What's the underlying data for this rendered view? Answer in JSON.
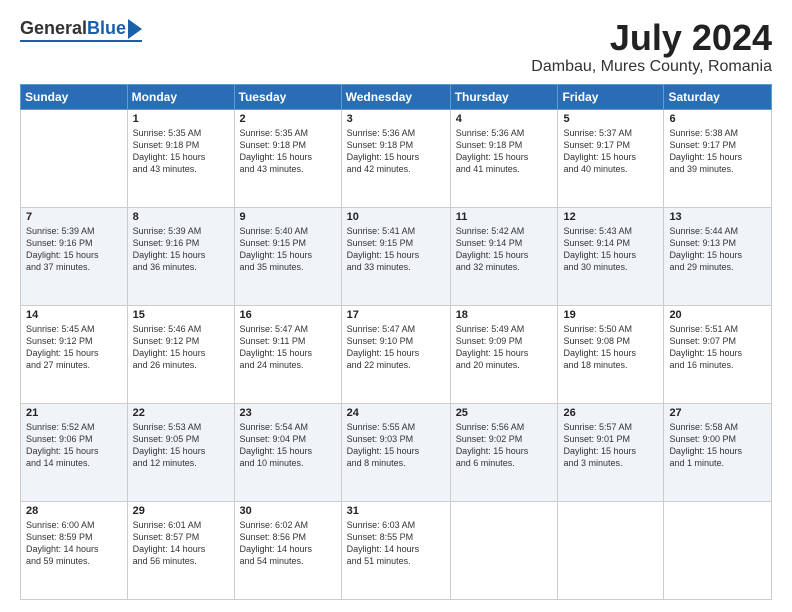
{
  "logo": {
    "general": "General",
    "blue": "Blue"
  },
  "title": "July 2024",
  "location": "Dambau, Mures County, Romania",
  "days": [
    "Sunday",
    "Monday",
    "Tuesday",
    "Wednesday",
    "Thursday",
    "Friday",
    "Saturday"
  ],
  "weeks": [
    [
      {
        "day": "",
        "info": ""
      },
      {
        "day": "1",
        "info": "Sunrise: 5:35 AM\nSunset: 9:18 PM\nDaylight: 15 hours\nand 43 minutes."
      },
      {
        "day": "2",
        "info": "Sunrise: 5:35 AM\nSunset: 9:18 PM\nDaylight: 15 hours\nand 43 minutes."
      },
      {
        "day": "3",
        "info": "Sunrise: 5:36 AM\nSunset: 9:18 PM\nDaylight: 15 hours\nand 42 minutes."
      },
      {
        "day": "4",
        "info": "Sunrise: 5:36 AM\nSunset: 9:18 PM\nDaylight: 15 hours\nand 41 minutes."
      },
      {
        "day": "5",
        "info": "Sunrise: 5:37 AM\nSunset: 9:17 PM\nDaylight: 15 hours\nand 40 minutes."
      },
      {
        "day": "6",
        "info": "Sunrise: 5:38 AM\nSunset: 9:17 PM\nDaylight: 15 hours\nand 39 minutes."
      }
    ],
    [
      {
        "day": "7",
        "info": "Sunrise: 5:39 AM\nSunset: 9:16 PM\nDaylight: 15 hours\nand 37 minutes."
      },
      {
        "day": "8",
        "info": "Sunrise: 5:39 AM\nSunset: 9:16 PM\nDaylight: 15 hours\nand 36 minutes."
      },
      {
        "day": "9",
        "info": "Sunrise: 5:40 AM\nSunset: 9:15 PM\nDaylight: 15 hours\nand 35 minutes."
      },
      {
        "day": "10",
        "info": "Sunrise: 5:41 AM\nSunset: 9:15 PM\nDaylight: 15 hours\nand 33 minutes."
      },
      {
        "day": "11",
        "info": "Sunrise: 5:42 AM\nSunset: 9:14 PM\nDaylight: 15 hours\nand 32 minutes."
      },
      {
        "day": "12",
        "info": "Sunrise: 5:43 AM\nSunset: 9:14 PM\nDaylight: 15 hours\nand 30 minutes."
      },
      {
        "day": "13",
        "info": "Sunrise: 5:44 AM\nSunset: 9:13 PM\nDaylight: 15 hours\nand 29 minutes."
      }
    ],
    [
      {
        "day": "14",
        "info": "Sunrise: 5:45 AM\nSunset: 9:12 PM\nDaylight: 15 hours\nand 27 minutes."
      },
      {
        "day": "15",
        "info": "Sunrise: 5:46 AM\nSunset: 9:12 PM\nDaylight: 15 hours\nand 26 minutes."
      },
      {
        "day": "16",
        "info": "Sunrise: 5:47 AM\nSunset: 9:11 PM\nDaylight: 15 hours\nand 24 minutes."
      },
      {
        "day": "17",
        "info": "Sunrise: 5:47 AM\nSunset: 9:10 PM\nDaylight: 15 hours\nand 22 minutes."
      },
      {
        "day": "18",
        "info": "Sunrise: 5:49 AM\nSunset: 9:09 PM\nDaylight: 15 hours\nand 20 minutes."
      },
      {
        "day": "19",
        "info": "Sunrise: 5:50 AM\nSunset: 9:08 PM\nDaylight: 15 hours\nand 18 minutes."
      },
      {
        "day": "20",
        "info": "Sunrise: 5:51 AM\nSunset: 9:07 PM\nDaylight: 15 hours\nand 16 minutes."
      }
    ],
    [
      {
        "day": "21",
        "info": "Sunrise: 5:52 AM\nSunset: 9:06 PM\nDaylight: 15 hours\nand 14 minutes."
      },
      {
        "day": "22",
        "info": "Sunrise: 5:53 AM\nSunset: 9:05 PM\nDaylight: 15 hours\nand 12 minutes."
      },
      {
        "day": "23",
        "info": "Sunrise: 5:54 AM\nSunset: 9:04 PM\nDaylight: 15 hours\nand 10 minutes."
      },
      {
        "day": "24",
        "info": "Sunrise: 5:55 AM\nSunset: 9:03 PM\nDaylight: 15 hours\nand 8 minutes."
      },
      {
        "day": "25",
        "info": "Sunrise: 5:56 AM\nSunset: 9:02 PM\nDaylight: 15 hours\nand 6 minutes."
      },
      {
        "day": "26",
        "info": "Sunrise: 5:57 AM\nSunset: 9:01 PM\nDaylight: 15 hours\nand 3 minutes."
      },
      {
        "day": "27",
        "info": "Sunrise: 5:58 AM\nSunset: 9:00 PM\nDaylight: 15 hours\nand 1 minute."
      }
    ],
    [
      {
        "day": "28",
        "info": "Sunrise: 6:00 AM\nSunset: 8:59 PM\nDaylight: 14 hours\nand 59 minutes."
      },
      {
        "day": "29",
        "info": "Sunrise: 6:01 AM\nSunset: 8:57 PM\nDaylight: 14 hours\nand 56 minutes."
      },
      {
        "day": "30",
        "info": "Sunrise: 6:02 AM\nSunset: 8:56 PM\nDaylight: 14 hours\nand 54 minutes."
      },
      {
        "day": "31",
        "info": "Sunrise: 6:03 AM\nSunset: 8:55 PM\nDaylight: 14 hours\nand 51 minutes."
      },
      {
        "day": "",
        "info": ""
      },
      {
        "day": "",
        "info": ""
      },
      {
        "day": "",
        "info": ""
      }
    ]
  ]
}
